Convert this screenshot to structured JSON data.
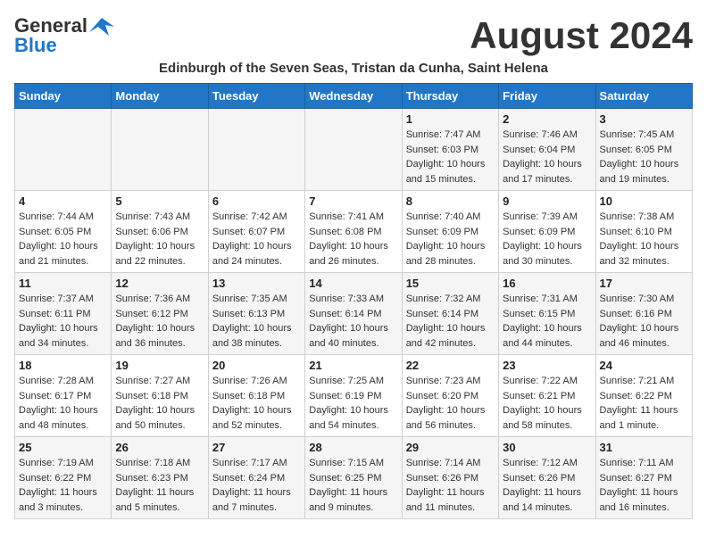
{
  "header": {
    "logo_general": "General",
    "logo_blue": "Blue",
    "month_title": "August 2024",
    "subtitle": "Edinburgh of the Seven Seas, Tristan da Cunha, Saint Helena"
  },
  "days_of_week": [
    "Sunday",
    "Monday",
    "Tuesday",
    "Wednesday",
    "Thursday",
    "Friday",
    "Saturday"
  ],
  "weeks": [
    [
      {
        "day": "",
        "info": ""
      },
      {
        "day": "",
        "info": ""
      },
      {
        "day": "",
        "info": ""
      },
      {
        "day": "",
        "info": ""
      },
      {
        "day": "1",
        "info": "Sunrise: 7:47 AM\nSunset: 6:03 PM\nDaylight: 10 hours\nand 15 minutes."
      },
      {
        "day": "2",
        "info": "Sunrise: 7:46 AM\nSunset: 6:04 PM\nDaylight: 10 hours\nand 17 minutes."
      },
      {
        "day": "3",
        "info": "Sunrise: 7:45 AM\nSunset: 6:05 PM\nDaylight: 10 hours\nand 19 minutes."
      }
    ],
    [
      {
        "day": "4",
        "info": "Sunrise: 7:44 AM\nSunset: 6:05 PM\nDaylight: 10 hours\nand 21 minutes."
      },
      {
        "day": "5",
        "info": "Sunrise: 7:43 AM\nSunset: 6:06 PM\nDaylight: 10 hours\nand 22 minutes."
      },
      {
        "day": "6",
        "info": "Sunrise: 7:42 AM\nSunset: 6:07 PM\nDaylight: 10 hours\nand 24 minutes."
      },
      {
        "day": "7",
        "info": "Sunrise: 7:41 AM\nSunset: 6:08 PM\nDaylight: 10 hours\nand 26 minutes."
      },
      {
        "day": "8",
        "info": "Sunrise: 7:40 AM\nSunset: 6:09 PM\nDaylight: 10 hours\nand 28 minutes."
      },
      {
        "day": "9",
        "info": "Sunrise: 7:39 AM\nSunset: 6:09 PM\nDaylight: 10 hours\nand 30 minutes."
      },
      {
        "day": "10",
        "info": "Sunrise: 7:38 AM\nSunset: 6:10 PM\nDaylight: 10 hours\nand 32 minutes."
      }
    ],
    [
      {
        "day": "11",
        "info": "Sunrise: 7:37 AM\nSunset: 6:11 PM\nDaylight: 10 hours\nand 34 minutes."
      },
      {
        "day": "12",
        "info": "Sunrise: 7:36 AM\nSunset: 6:12 PM\nDaylight: 10 hours\nand 36 minutes."
      },
      {
        "day": "13",
        "info": "Sunrise: 7:35 AM\nSunset: 6:13 PM\nDaylight: 10 hours\nand 38 minutes."
      },
      {
        "day": "14",
        "info": "Sunrise: 7:33 AM\nSunset: 6:14 PM\nDaylight: 10 hours\nand 40 minutes."
      },
      {
        "day": "15",
        "info": "Sunrise: 7:32 AM\nSunset: 6:14 PM\nDaylight: 10 hours\nand 42 minutes."
      },
      {
        "day": "16",
        "info": "Sunrise: 7:31 AM\nSunset: 6:15 PM\nDaylight: 10 hours\nand 44 minutes."
      },
      {
        "day": "17",
        "info": "Sunrise: 7:30 AM\nSunset: 6:16 PM\nDaylight: 10 hours\nand 46 minutes."
      }
    ],
    [
      {
        "day": "18",
        "info": "Sunrise: 7:28 AM\nSunset: 6:17 PM\nDaylight: 10 hours\nand 48 minutes."
      },
      {
        "day": "19",
        "info": "Sunrise: 7:27 AM\nSunset: 6:18 PM\nDaylight: 10 hours\nand 50 minutes."
      },
      {
        "day": "20",
        "info": "Sunrise: 7:26 AM\nSunset: 6:18 PM\nDaylight: 10 hours\nand 52 minutes."
      },
      {
        "day": "21",
        "info": "Sunrise: 7:25 AM\nSunset: 6:19 PM\nDaylight: 10 hours\nand 54 minutes."
      },
      {
        "day": "22",
        "info": "Sunrise: 7:23 AM\nSunset: 6:20 PM\nDaylight: 10 hours\nand 56 minutes."
      },
      {
        "day": "23",
        "info": "Sunrise: 7:22 AM\nSunset: 6:21 PM\nDaylight: 10 hours\nand 58 minutes."
      },
      {
        "day": "24",
        "info": "Sunrise: 7:21 AM\nSunset: 6:22 PM\nDaylight: 11 hours\nand 1 minute."
      }
    ],
    [
      {
        "day": "25",
        "info": "Sunrise: 7:19 AM\nSunset: 6:22 PM\nDaylight: 11 hours\nand 3 minutes."
      },
      {
        "day": "26",
        "info": "Sunrise: 7:18 AM\nSunset: 6:23 PM\nDaylight: 11 hours\nand 5 minutes."
      },
      {
        "day": "27",
        "info": "Sunrise: 7:17 AM\nSunset: 6:24 PM\nDaylight: 11 hours\nand 7 minutes."
      },
      {
        "day": "28",
        "info": "Sunrise: 7:15 AM\nSunset: 6:25 PM\nDaylight: 11 hours\nand 9 minutes."
      },
      {
        "day": "29",
        "info": "Sunrise: 7:14 AM\nSunset: 6:26 PM\nDaylight: 11 hours\nand 11 minutes."
      },
      {
        "day": "30",
        "info": "Sunrise: 7:12 AM\nSunset: 6:26 PM\nDaylight: 11 hours\nand 14 minutes."
      },
      {
        "day": "31",
        "info": "Sunrise: 7:11 AM\nSunset: 6:27 PM\nDaylight: 11 hours\nand 16 minutes."
      }
    ]
  ]
}
